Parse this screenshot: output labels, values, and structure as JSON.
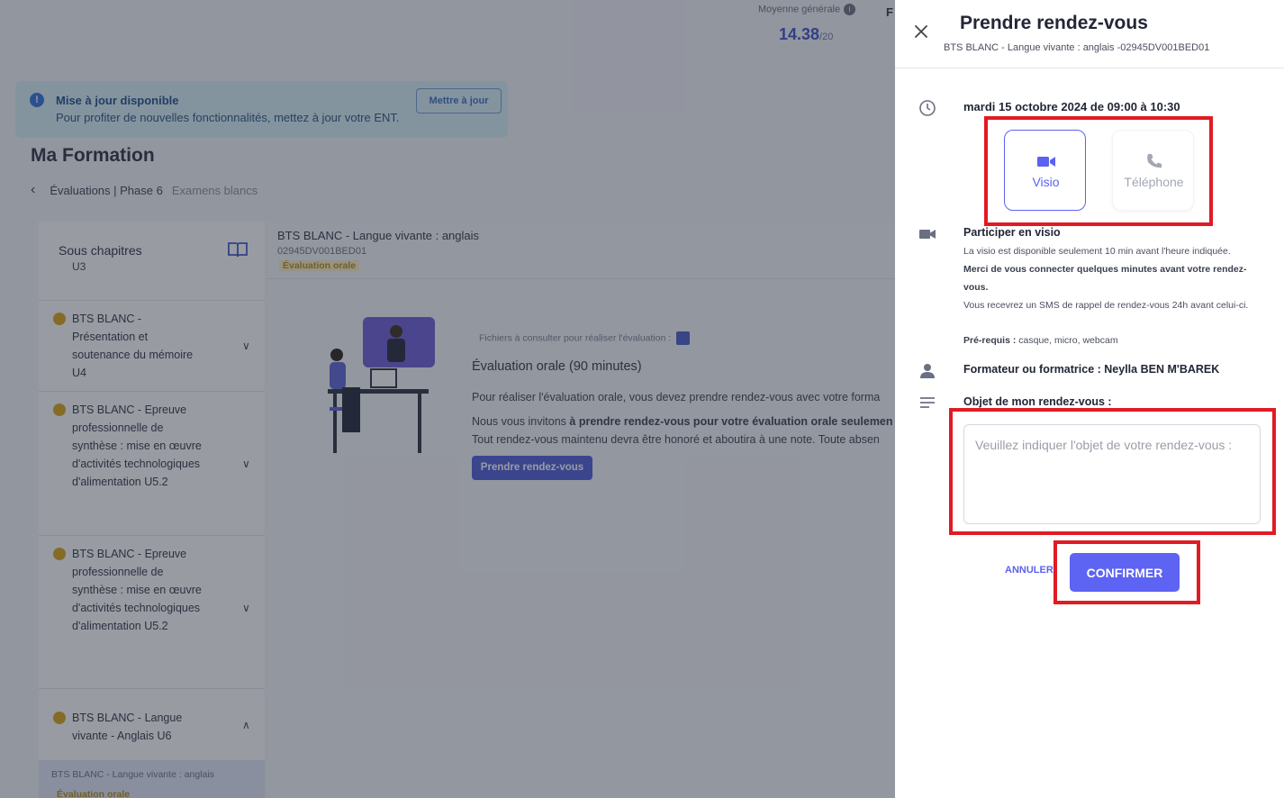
{
  "background": {
    "stat_label": "Moyenne générale",
    "stat_value": "14.38",
    "stat_denominator": "/20",
    "stat_side_letter": "F",
    "banner": {
      "title": "Mise à jour disponible",
      "text": "Pour profiter de nouvelles fonctionnalités, mettez à jour votre ENT.",
      "button": "Mettre à jour"
    },
    "page_title": "Ma Formation",
    "breadcrumb": {
      "path": "Évaluations | Phase 6",
      "current": "Examens blancs"
    },
    "sidebar": {
      "heading": "Sous chapitres",
      "cut_item": "U3",
      "items": [
        {
          "label": "BTS BLANC - Présentation et soutenance du mémoire U4"
        },
        {
          "label": "BTS BLANC - Epreuve professionnelle de synthèse : mise en œuvre d'activités technologiques d'alimentation U5.2"
        },
        {
          "label": "BTS BLANC - Epreuve professionnelle de synthèse : mise en œuvre d'activités technologiques d'alimentation U5.2"
        },
        {
          "label": "BTS BLANC - Langue vivante - Anglais U6"
        }
      ],
      "sub_item": {
        "title": "BTS BLANC - Langue vivante : anglais",
        "badge": "Évaluation orale"
      }
    },
    "main": {
      "title": "BTS BLANC - Langue vivante : anglais",
      "code": "02945DV001BED01",
      "badge": "Évaluation orale",
      "files_label": "Fichiers à consulter pour réaliser l'évaluation :",
      "heading": "Évaluation orale (90 minutes)",
      "para1": "Pour réaliser l'évaluation orale, vous devez prendre rendez-vous avec votre forma",
      "para2_prefix": "Nous vous invitons ",
      "para2_bold": "à prendre rendez-vous pour votre évaluation orale seulemen",
      "para3": "Tout rendez-vous maintenu devra être honoré et aboutira à une note. Toute absen",
      "button": "Prendre rendez-vous"
    }
  },
  "drawer": {
    "title": "Prendre rendez-vous",
    "subtitle": "BTS BLANC - Langue vivante : anglais -02945DV001BED01",
    "datetime": "mardi 15 octobre 2024 de 09:00 à 10:30",
    "modes": [
      {
        "label": "Visio",
        "icon": "video-camera-icon",
        "selected": true
      },
      {
        "label": "Téléphone",
        "icon": "phone-icon",
        "selected": false
      }
    ],
    "visio": {
      "title": "Participer en visio",
      "line1": "La visio est disponible seulement 10 min avant l'heure indiquée.",
      "line2": "Merci de vous connecter quelques minutes avant votre rendez-vous.",
      "line3": "Vous recevrez un SMS de rappel de rendez-vous 24h avant celui-ci.",
      "prereq_label": "Pré-requis :",
      "prereq_value": " casque, micro, webcam"
    },
    "trainer": "Formateur ou formatrice : Neylla BEN M'BAREK",
    "object_label": "Objet de mon rendez-vous :",
    "object_value": "",
    "object_placeholder": "Veuillez indiquer l'objet de votre rendez-vous :",
    "cancel": "ANNULER",
    "confirm": "CONFIRMER"
  },
  "colors": {
    "accent": "#5d63f2",
    "highlight": "#e01b24",
    "badge": "#d9a514"
  }
}
